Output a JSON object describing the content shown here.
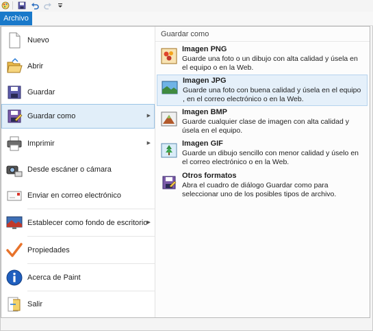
{
  "tabs": {
    "file": "Archivo"
  },
  "menu_items": [
    {
      "label": "Nuevo",
      "has_submenu": false
    },
    {
      "label": "Abrir",
      "has_submenu": false
    },
    {
      "label": "Guardar",
      "has_submenu": false
    },
    {
      "label": "Guardar como",
      "has_submenu": true
    },
    {
      "label": "Imprimir",
      "has_submenu": true
    },
    {
      "label": "Desde escáner o cámara",
      "has_submenu": false
    },
    {
      "label": "Enviar en correo electrónico",
      "has_submenu": false
    },
    {
      "label": "Establecer como fondo de escritorio",
      "has_submenu": true
    },
    {
      "label": "Propiedades",
      "has_submenu": false
    },
    {
      "label": "Acerca de Paint",
      "has_submenu": false
    },
    {
      "label": "Salir",
      "has_submenu": false
    }
  ],
  "submenu_arrow": "▶",
  "panel": {
    "heading": "Guardar como",
    "options": [
      {
        "title": "Imagen PNG",
        "description": "Guarde una foto o un dibujo con alta calidad y úsela en el equipo o en la Web."
      },
      {
        "title": "Imagen JPG",
        "description": "Guarde una foto con buena calidad y úsela en el equipo , en el correo electrónico o en la Web."
      },
      {
        "title": "Imagen BMP",
        "description": "Guarde cualquier clase de imagen con alta calidad y úsela en el equipo."
      },
      {
        "title": "Imagen GIF",
        "description": "Guarde un dibujo sencillo con menor calidad y úselo en el correo electrónico o en la Web."
      },
      {
        "title": "Otros formatos",
        "description": "Abra el cuadro de diálogo Guardar como para seleccionar uno de los posibles tipos de archivo."
      }
    ]
  },
  "colors": {
    "accent": "#1979ca",
    "highlight": "#e1eef9",
    "highlight_border": "#9ac3e6"
  }
}
